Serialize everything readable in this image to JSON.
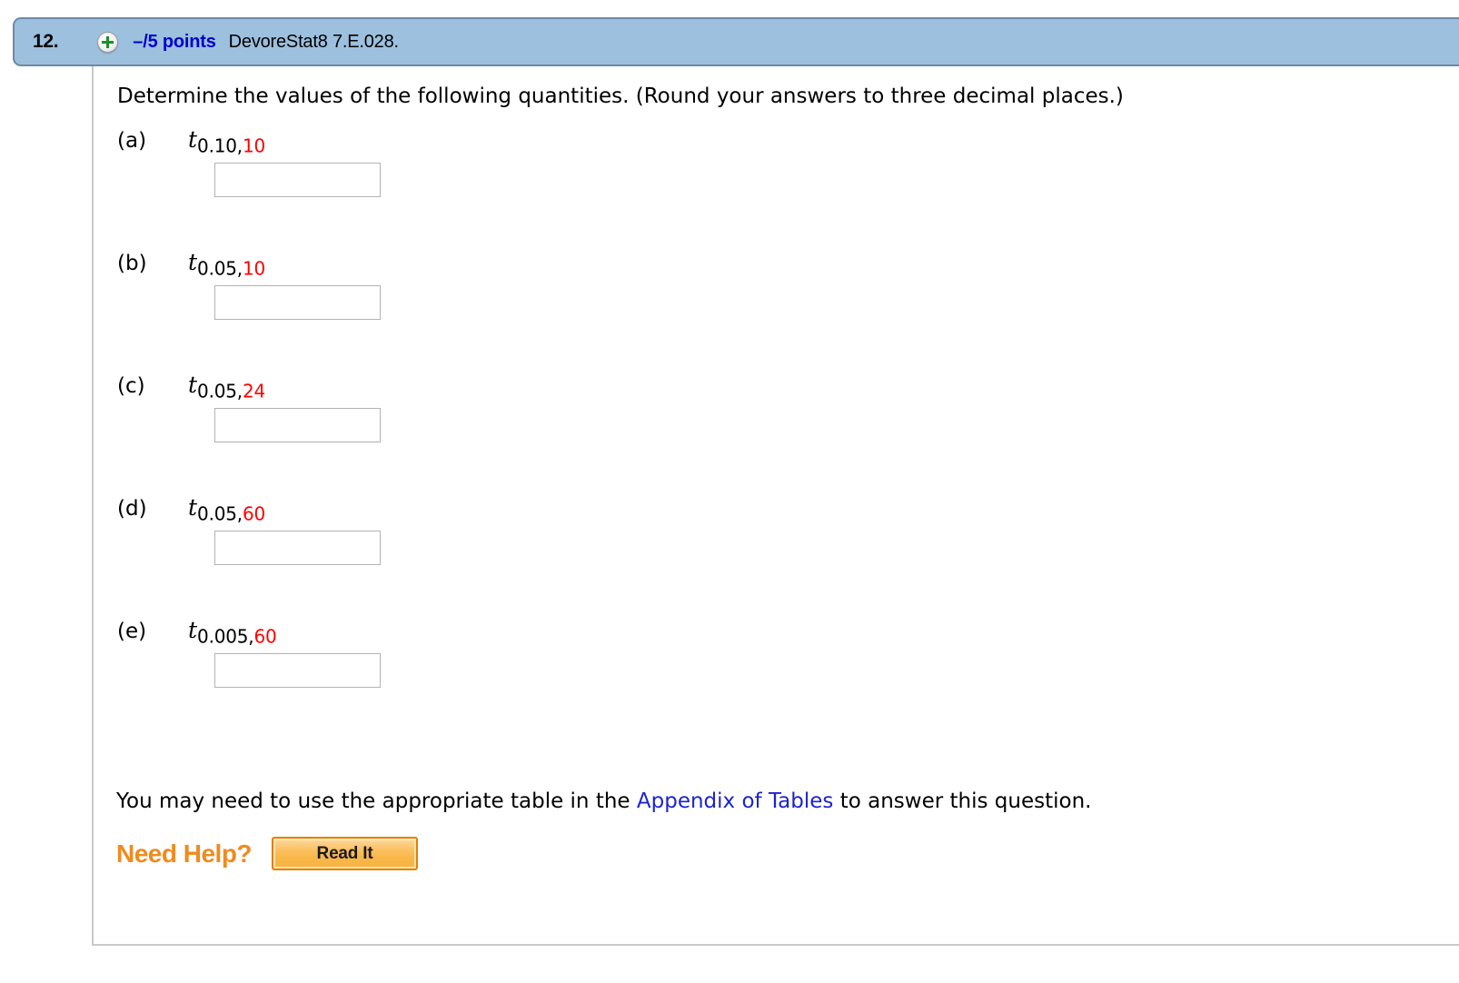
{
  "header": {
    "question_number": "12.",
    "expand_icon": "plus-circle-icon",
    "points": "–/5 points",
    "assignment_code": "DevoreStat8 7.E.028."
  },
  "main": {
    "prompt": "Determine the values of the following quantities. (Round your answers to three decimal places.)",
    "parts": [
      {
        "letter": "(a)",
        "symbol": "t",
        "sub_black": "0.10,",
        "sub_red": "10",
        "input_value": "",
        "input_placeholder": ""
      },
      {
        "letter": "(b)",
        "symbol": "t",
        "sub_black": "0.05,",
        "sub_red": "10",
        "input_value": "",
        "input_placeholder": ""
      },
      {
        "letter": "(c)",
        "symbol": "t",
        "sub_black": "0.05,",
        "sub_red": "24",
        "input_value": "",
        "input_placeholder": ""
      },
      {
        "letter": "(d)",
        "symbol": "t",
        "sub_black": "0.05,",
        "sub_red": "60",
        "input_value": "",
        "input_placeholder": ""
      },
      {
        "letter": "(e)",
        "symbol": "t",
        "sub_black": "0.005,",
        "sub_red": "60",
        "input_value": "",
        "input_placeholder": ""
      }
    ],
    "footer_note": {
      "before_link": "You may need to use the appropriate table in the ",
      "link_text": "Appendix of Tables",
      "after_link": " to answer this question."
    },
    "need_help": {
      "label": "Need Help?",
      "button_label": "Read It"
    }
  },
  "colors": {
    "header_blue": "#9cc0de",
    "header_border": "#6d8aa5",
    "points_blue": "#0000cd",
    "subscript_red": "#ff0000",
    "link_blue": "#1c23cf",
    "need_help_orange": "#ef8b1f",
    "button_orange": "#f8b441",
    "button_border": "#e08200"
  }
}
